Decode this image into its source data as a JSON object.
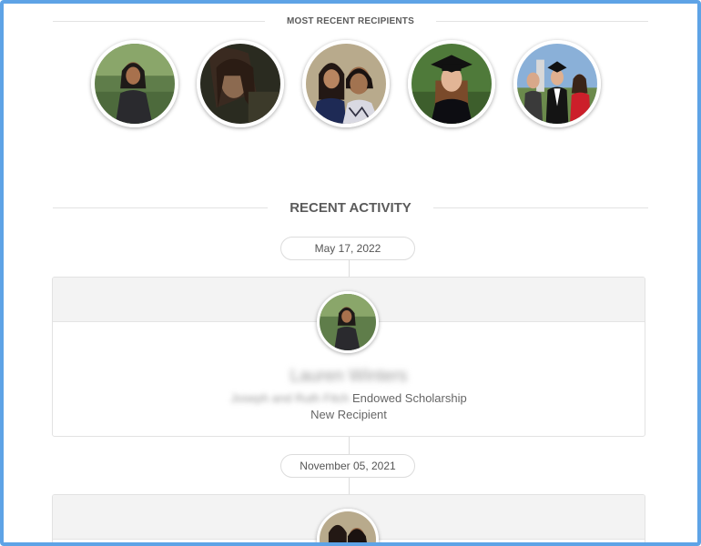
{
  "recipients_section": {
    "title": "MOST RECENT RECIPIENTS",
    "avatars": [
      {
        "icon": "student-photo"
      },
      {
        "icon": "student-photo"
      },
      {
        "icon": "student-photo"
      },
      {
        "icon": "student-photo"
      },
      {
        "icon": "student-photo"
      }
    ]
  },
  "activity_section": {
    "title": "RECENT ACTIVITY",
    "items": [
      {
        "date": "May 17, 2022",
        "name": "Lauren Winters",
        "scholarship_prefix": "Joseph and Ruth Fitch",
        "scholarship_suffix": "Endowed Scholarship",
        "status": "New Recipient"
      },
      {
        "date": "November 05, 2021"
      }
    ]
  },
  "colors": {
    "frame_border": "#5ea3e6",
    "rule": "#e3e3e3",
    "card_band": "#f3f3f3"
  }
}
